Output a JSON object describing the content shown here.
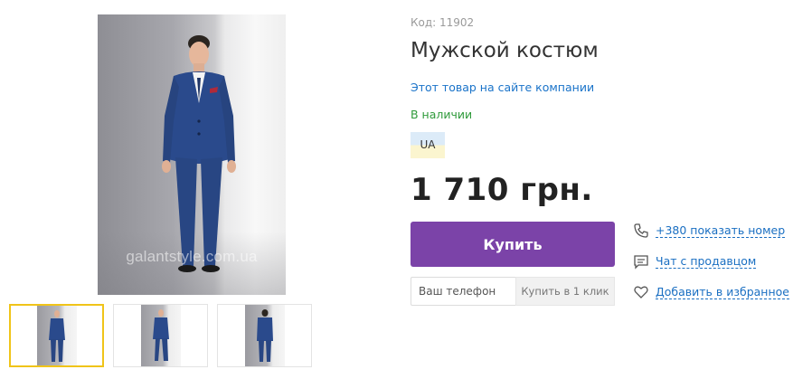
{
  "gallery": {
    "watermark": "galantstyle.com.ua",
    "thumbnail_count": 3,
    "active_thumbnail": 1
  },
  "product": {
    "code": "Код: 11902",
    "title": "Мужской костюм",
    "company_link": "Этот товар на сайте компании",
    "availability": "В наличии",
    "badge": "UA",
    "price": "1 710 грн."
  },
  "actions": {
    "buy_label": "Купить",
    "phone_placeholder": "Ваш телефон",
    "oneclick_label": "Купить в 1 клик"
  },
  "contact": {
    "phone_link": "+380 показать номер",
    "chat_link": "Чат с продавцом",
    "favorite_link": "Добавить в избранное"
  },
  "colors": {
    "buy_button": "#7b43a8",
    "link": "#1a6fc2",
    "availability": "#2e9a3a",
    "active_thumb_border": "#f0c419",
    "suit": "#2a4a8c"
  }
}
